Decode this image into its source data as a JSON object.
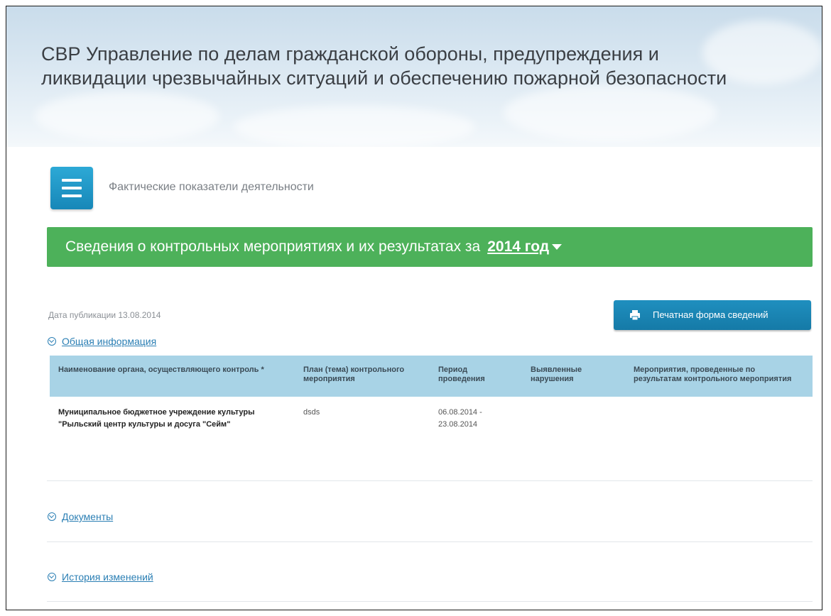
{
  "header": {
    "title": "СВР Управление по делам гражданской обороны, предупреждения и ликвидации чрезвычайных ситуаций и обеспечению пожарной безопасности"
  },
  "menu": {
    "icon": "hamburger-menu-icon",
    "label": "Фактические показатели деятельности"
  },
  "banner": {
    "text": "Сведения о контрольных мероприятиях и их результатах за",
    "year": "2014 год",
    "color": "#4db15a"
  },
  "publication": {
    "date_label": "Дата публикации 13.08.2014"
  },
  "print_button": {
    "label": "Печатная форма сведений",
    "icon": "printer-icon"
  },
  "sections": {
    "general": "Общая информация",
    "documents": "Документы",
    "history": "История изменений"
  },
  "table": {
    "headers": [
      "Наименование органа, осуществляющего контроль *",
      "План (тема) контрольного мероприятия",
      "Период проведения",
      "Выявленные нарушения",
      "Мероприятия, проведенные по результатам контрольного мероприятия"
    ],
    "rows": [
      {
        "org": "Муниципальное бюджетное учреждение культуры \"Рыльский центр культуры и досуга \"Сейм\"",
        "plan": "dsds",
        "period": "06.08.2014 - 23.08.2014",
        "violations": "",
        "measures": ""
      }
    ]
  },
  "colors": {
    "accent": "#1f8fbf",
    "table_header": "#a8d3e6",
    "link": "#2b7fb4"
  }
}
